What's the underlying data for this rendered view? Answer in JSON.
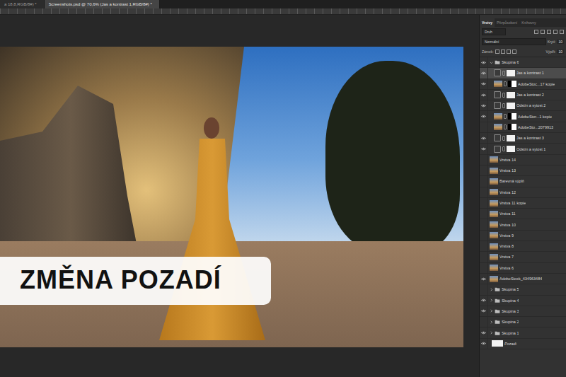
{
  "window": {
    "tabs": [
      {
        "label": "a 18,8,RGB/8#) *",
        "selected": false
      },
      {
        "label": "Screenshots.psd @ 70,6% (Jas a kontrast 1,RGB/8#) *",
        "selected": true
      }
    ]
  },
  "canvas": {
    "banner": "ZMĚNA POZADÍ"
  },
  "panel": {
    "tabs": [
      {
        "label": "Vrstvy",
        "selected": true
      },
      {
        "label": "Přizpůsobení",
        "selected": false
      },
      {
        "label": "Knihovny",
        "selected": false
      }
    ],
    "filter": "Druh",
    "blend": "Normální",
    "opacity_label": "Krytí:",
    "opacity": "10",
    "lock_label": "Zámek:",
    "fill_label": "Výplň:",
    "fill": "10"
  },
  "layers": [
    {
      "name": "Skupina 6",
      "kind": "group",
      "visible": true,
      "selected": false,
      "expanded": true
    },
    {
      "name": "Jas a kontrast 1",
      "kind": "adjustment",
      "visible": true,
      "selected": true,
      "expanded": false
    },
    {
      "name": "AdobeStoc...17 kopie",
      "kind": "masked",
      "visible": true,
      "selected": false,
      "expanded": false
    },
    {
      "name": "Jas a kontrast 2",
      "kind": "adjustment",
      "visible": true,
      "selected": false,
      "expanded": false
    },
    {
      "name": "Odstín a sytost 2",
      "kind": "adjustment",
      "visible": true,
      "selected": false,
      "expanded": false
    },
    {
      "name": "AdobeStor...1 kopie",
      "kind": "masked",
      "visible": true,
      "selected": false,
      "expanded": false
    },
    {
      "name": "AdobeSto...2079913",
      "kind": "masked",
      "visible": false,
      "selected": false,
      "expanded": false
    },
    {
      "name": "Jas a kontrast 3",
      "kind": "adjustment",
      "visible": true,
      "selected": false,
      "expanded": false
    },
    {
      "name": "Odstín a sytost 1",
      "kind": "adjustment",
      "visible": true,
      "selected": false,
      "expanded": false
    },
    {
      "name": "Vrstva 14",
      "kind": "layer",
      "visible": false,
      "selected": false,
      "expanded": false
    },
    {
      "name": "Vrstva 13",
      "kind": "layer",
      "visible": false,
      "selected": false,
      "expanded": false
    },
    {
      "name": "Barevná výplň",
      "kind": "layer",
      "visible": false,
      "selected": false,
      "expanded": false
    },
    {
      "name": "Vrstva 12",
      "kind": "layer",
      "visible": false,
      "selected": false,
      "expanded": false
    },
    {
      "name": "Vrstva 11 kopie",
      "kind": "layer",
      "visible": false,
      "selected": false,
      "expanded": false
    },
    {
      "name": "Vrstva 11",
      "kind": "layer",
      "visible": false,
      "selected": false,
      "expanded": false
    },
    {
      "name": "Vrstva 10",
      "kind": "layer",
      "visible": false,
      "selected": false,
      "expanded": false
    },
    {
      "name": "Vrstva 9",
      "kind": "layer",
      "visible": false,
      "selected": false,
      "expanded": false
    },
    {
      "name": "Vrstva 8",
      "kind": "layer",
      "visible": false,
      "selected": false,
      "expanded": false
    },
    {
      "name": "Vrstva 7",
      "kind": "layer",
      "visible": false,
      "selected": false,
      "expanded": false
    },
    {
      "name": "Vrstva 6",
      "kind": "layer",
      "visible": false,
      "selected": false,
      "expanded": false
    },
    {
      "name": "AdobeStock_434963484",
      "kind": "layer",
      "visible": true,
      "selected": false,
      "expanded": false
    },
    {
      "name": "Skupina 5",
      "kind": "group",
      "visible": false,
      "selected": false,
      "expanded": false
    },
    {
      "name": "Skupina 4",
      "kind": "group",
      "visible": true,
      "selected": false,
      "expanded": false
    },
    {
      "name": "Skupina 3",
      "kind": "group",
      "visible": true,
      "selected": false,
      "expanded": false
    },
    {
      "name": "Skupina 2",
      "kind": "group",
      "visible": false,
      "selected": false,
      "expanded": false
    },
    {
      "name": "Skupina 1",
      "kind": "group",
      "visible": true,
      "selected": false,
      "expanded": false
    },
    {
      "name": "Pozadí",
      "kind": "background",
      "visible": true,
      "selected": false,
      "expanded": false
    }
  ]
}
